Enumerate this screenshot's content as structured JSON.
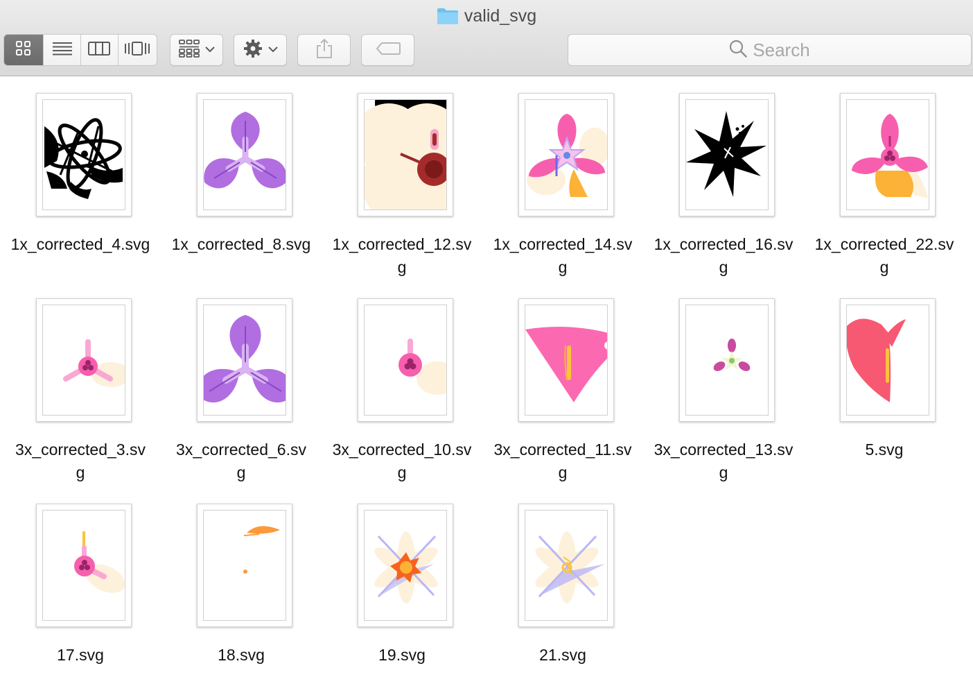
{
  "window": {
    "title": "valid_svg",
    "title_icon": "folder-icon"
  },
  "toolbar": {
    "view_modes": [
      {
        "name": "icon-view",
        "icon": "grid-icon",
        "active": true
      },
      {
        "name": "list-view",
        "icon": "list-icon",
        "active": false
      },
      {
        "name": "column-view",
        "icon": "columns-icon",
        "active": false
      },
      {
        "name": "cover-flow-view",
        "icon": "coverflow-icon",
        "active": false
      }
    ],
    "arrange_icon": "arrange-icon",
    "action_icon": "gear-icon",
    "share_icon": "share-icon",
    "tags_icon": "tag-icon"
  },
  "search": {
    "placeholder": "Search",
    "icon": "search-icon"
  },
  "files": [
    {
      "name": "1x_corrected_4.svg",
      "label": "1x_corrected_4.svg"
    },
    {
      "name": "1x_corrected_8.svg",
      "label": "1x_corrected_8.svg"
    },
    {
      "name": "1x_corrected_12.svg",
      "label": "1x_corrected_12.sv\ng"
    },
    {
      "name": "1x_corrected_14.svg",
      "label": "1x_corrected_14.sv\ng"
    },
    {
      "name": "1x_corrected_16.svg",
      "label": "1x_corrected_16.sv\ng"
    },
    {
      "name": "1x_corrected_22.svg",
      "label": "1x_corrected_22.sv\ng"
    },
    {
      "name": "3x_corrected_3.svg",
      "label": "3x_corrected_3.sv\ng"
    },
    {
      "name": "3x_corrected_6.svg",
      "label": "3x_corrected_6.sv\ng"
    },
    {
      "name": "3x_corrected_10.svg",
      "label": "3x_corrected_10.sv\ng"
    },
    {
      "name": "3x_corrected_11.svg",
      "label": "3x_corrected_11.sv\ng"
    },
    {
      "name": "3x_corrected_13.svg",
      "label": "3x_corrected_13.sv\ng"
    },
    {
      "name": "5.svg",
      "label": "5.svg"
    },
    {
      "name": "17.svg",
      "label": "17.svg"
    },
    {
      "name": "18.svg",
      "label": "18.svg"
    },
    {
      "name": "19.svg",
      "label": "19.svg"
    },
    {
      "name": "21.svg",
      "label": "21.svg"
    }
  ]
}
